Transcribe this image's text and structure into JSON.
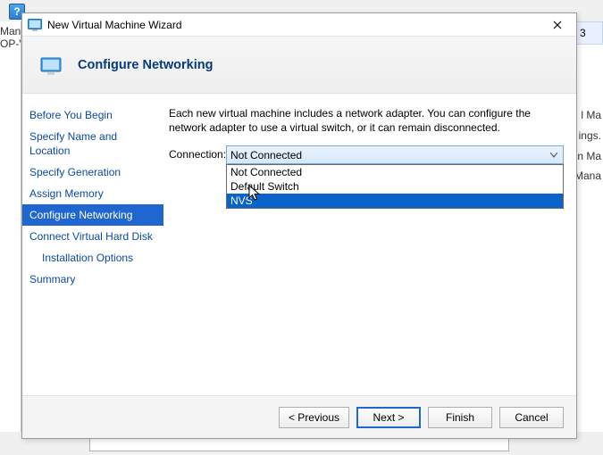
{
  "window": {
    "title": "New Virtual Machine Wizard"
  },
  "header": {
    "page_title": "Configure Networking"
  },
  "nav": {
    "items": [
      {
        "label": "Before You Begin",
        "selected": false,
        "indent": false
      },
      {
        "label": "Specify Name and Location",
        "selected": false,
        "indent": false
      },
      {
        "label": "Specify Generation",
        "selected": false,
        "indent": false
      },
      {
        "label": "Assign Memory",
        "selected": false,
        "indent": false
      },
      {
        "label": "Configure Networking",
        "selected": true,
        "indent": false
      },
      {
        "label": "Connect Virtual Hard Disk",
        "selected": false,
        "indent": false
      },
      {
        "label": "Installation Options",
        "selected": false,
        "indent": true
      },
      {
        "label": "Summary",
        "selected": false,
        "indent": false
      }
    ]
  },
  "content": {
    "description": "Each new virtual machine includes a network adapter. You can configure the network adapter to use a virtual switch, or it can remain disconnected.",
    "connection_label": "Connection:",
    "combo_selected": "Not Connected",
    "dropdown_options": [
      {
        "label": "Not Connected",
        "highlight": false
      },
      {
        "label": "Default Switch",
        "highlight": false
      },
      {
        "label": "NVS",
        "highlight": true
      }
    ]
  },
  "footer": {
    "previous": "< Previous",
    "next": "Next >",
    "finish": "Finish",
    "cancel": "Cancel"
  },
  "background": {
    "help_glyph": "?",
    "left1": "Manag",
    "left2": "OP-V",
    "right_tab": "3",
    "right1": "l Ma",
    "right2": "ings.",
    "right3": "n Ma",
    "right4": "Mana"
  }
}
